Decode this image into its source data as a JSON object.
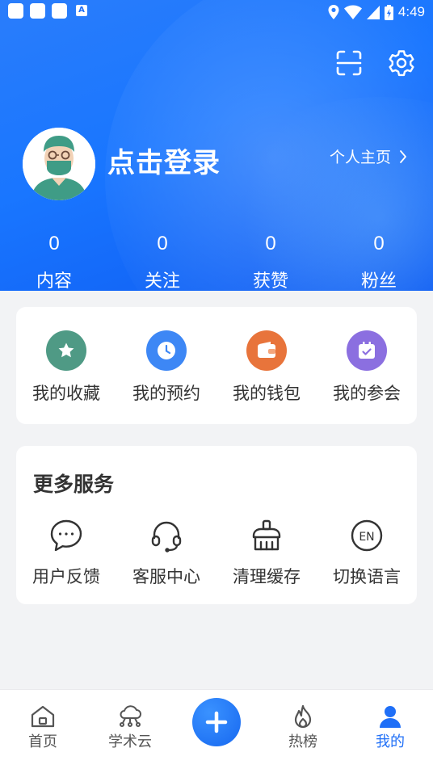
{
  "status_bar": {
    "time": "4:49",
    "badge": "A"
  },
  "header": {
    "login_text": "点击登录",
    "profile_link": "个人主页"
  },
  "stats": [
    {
      "value": "0",
      "label": "内容"
    },
    {
      "value": "0",
      "label": "关注"
    },
    {
      "value": "0",
      "label": "获赞"
    },
    {
      "value": "0",
      "label": "粉丝"
    }
  ],
  "quick_actions": [
    {
      "label": "我的收藏",
      "icon": "star-icon",
      "color": "#4f9a85"
    },
    {
      "label": "我的预约",
      "icon": "clock-icon",
      "color": "#3d87f5"
    },
    {
      "label": "我的钱包",
      "icon": "wallet-icon",
      "color": "#e8743b"
    },
    {
      "label": "我的参会",
      "icon": "calendar-check-icon",
      "color": "#8b6fe0"
    }
  ],
  "more_services": {
    "title": "更多服务",
    "items": [
      {
        "label": "用户反馈",
        "icon": "chat-bubble-icon"
      },
      {
        "label": "客服中心",
        "icon": "headset-icon"
      },
      {
        "label": "清理缓存",
        "icon": "broom-icon"
      },
      {
        "label": "切换语言",
        "icon": "language-en-icon",
        "glyph": "EN"
      }
    ]
  },
  "tabbar": {
    "items": [
      {
        "label": "首页",
        "icon": "home-icon"
      },
      {
        "label": "学术云",
        "icon": "cloud-network-icon"
      },
      {
        "label": "热榜",
        "icon": "flame-icon"
      },
      {
        "label": "我的",
        "icon": "person-icon",
        "active": true
      }
    ],
    "center_action": "plus-icon"
  },
  "colors": {
    "primary": "#1f6ff7",
    "background": "#f2f3f5"
  }
}
